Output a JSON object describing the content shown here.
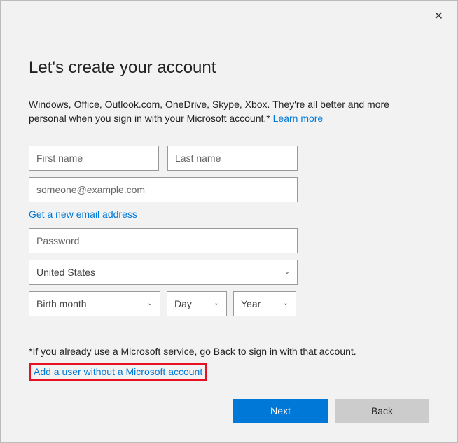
{
  "close_glyph": "✕",
  "title": "Let's create your account",
  "description_part1": "Windows, Office, Outlook.com, OneDrive, Skype, Xbox. They're all better and more personal when you sign in with your Microsoft account.* ",
  "learn_more": "Learn more",
  "placeholders": {
    "first_name": "First name",
    "last_name": "Last name",
    "email": "someone@example.com",
    "password": "Password"
  },
  "new_email_link": "Get a new email address",
  "country": "United States",
  "birth": {
    "month": "Birth month",
    "day": "Day",
    "year": "Year"
  },
  "chevron": "⌄",
  "footnote": "*If you already use a Microsoft service, go Back to sign in with that account.",
  "no_ms_account_link": "Add a user without a Microsoft account",
  "buttons": {
    "next": "Next",
    "back": "Back"
  }
}
